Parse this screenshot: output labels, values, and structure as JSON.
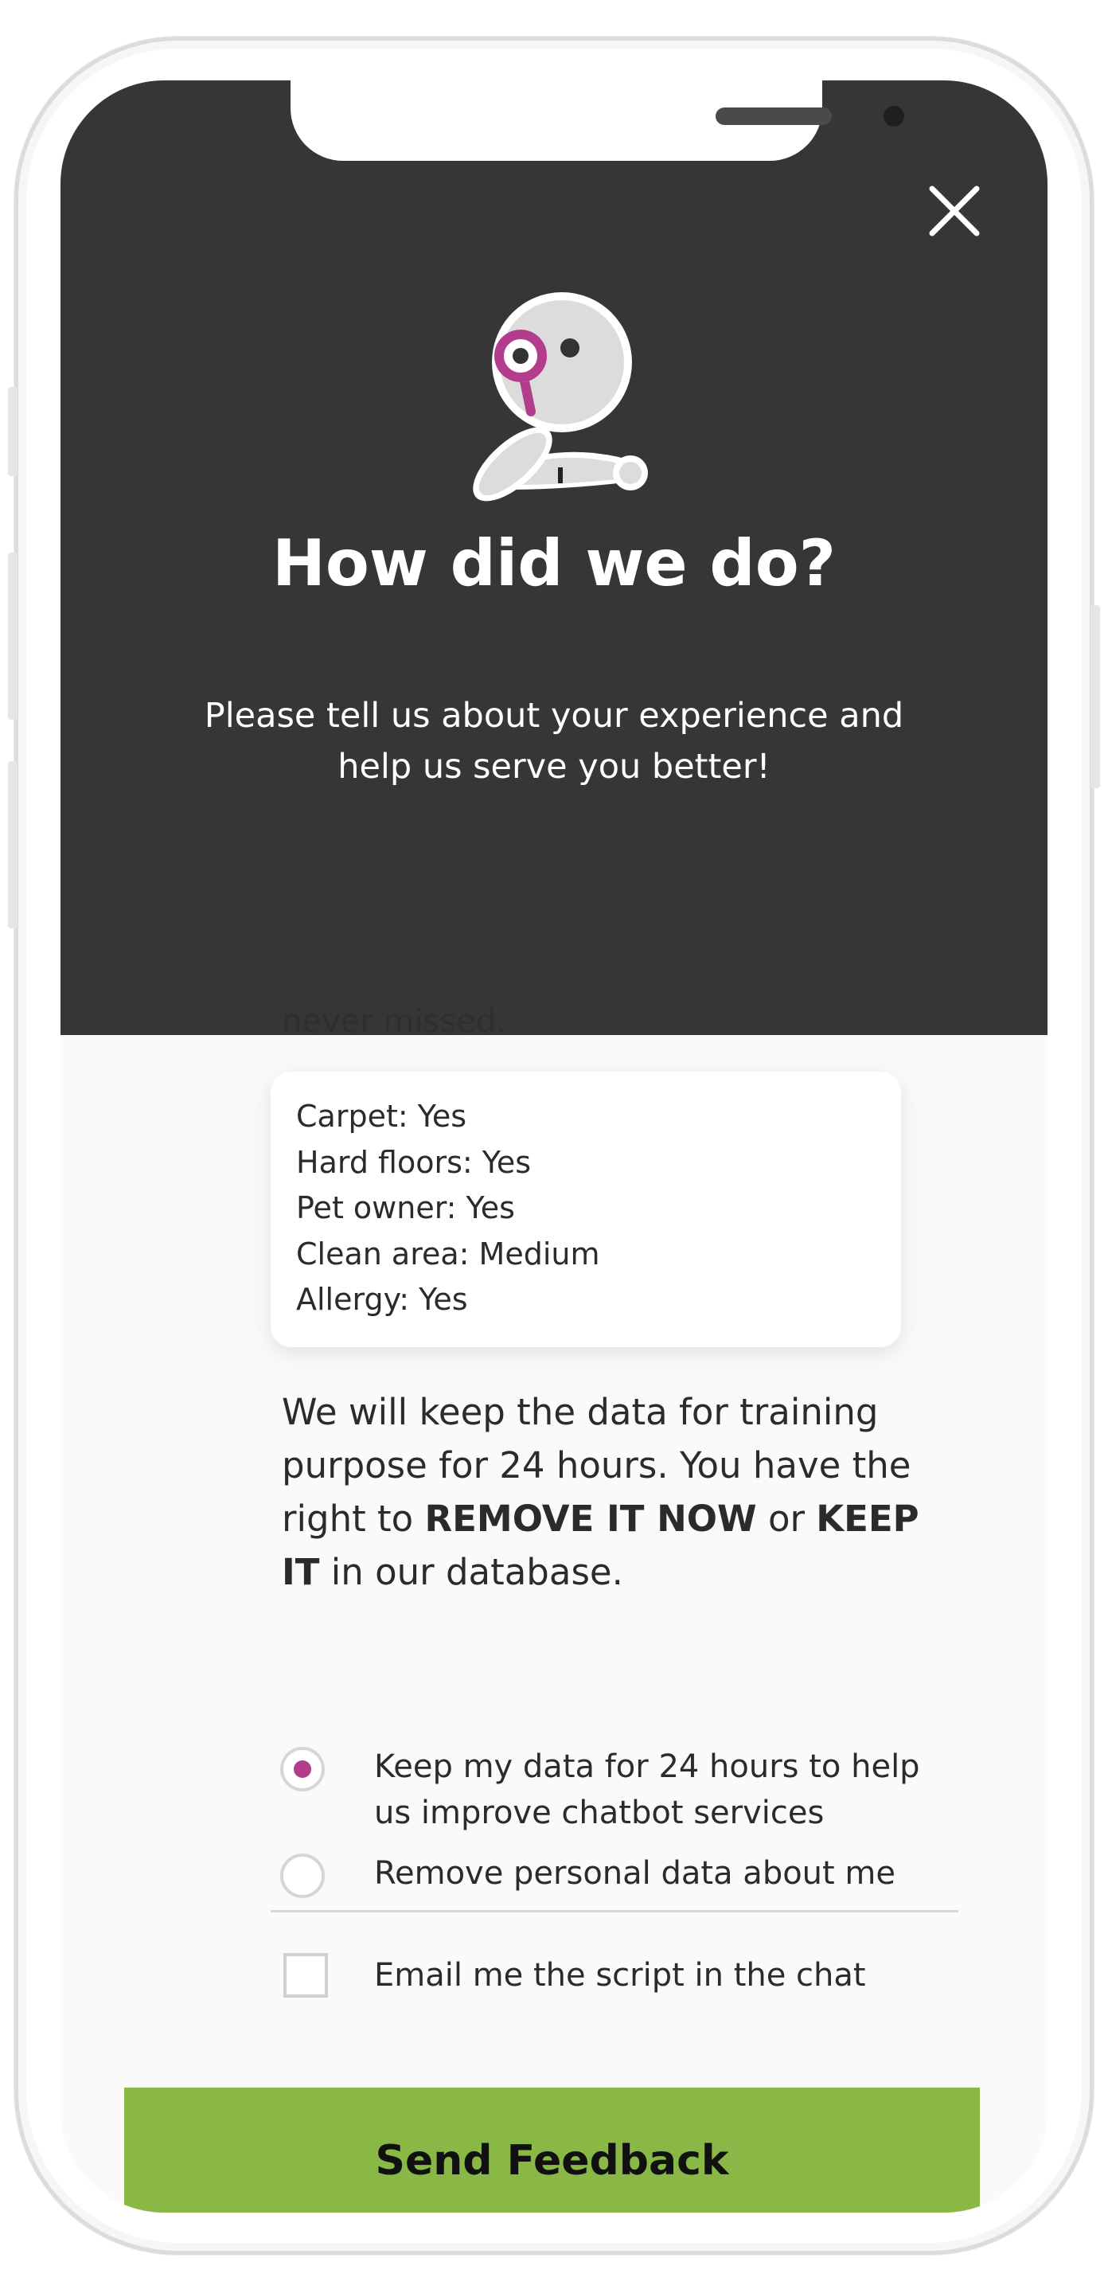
{
  "header": {
    "title": "How did we do?",
    "subtitle": "Please tell us about your experience and help us serve you better!",
    "close_icon": "close-icon",
    "mascot_icon": "robot-magnifier-icon"
  },
  "summary": {
    "cut_off_text": "never missed.",
    "items": [
      "Carpet: Yes",
      "Hard floors: Yes",
      "Pet owner: Yes",
      "Clean area: Medium",
      "Allergy: Yes"
    ]
  },
  "notice": {
    "part1": "We will keep the data for training purpose for 24 hours. You have the right to ",
    "remove_bold": "REMOVE IT NOW",
    "part2": " or ",
    "keep_bold": "KEEP IT",
    "part3": " in our database."
  },
  "options": {
    "keep_label": "Keep my data for 24 hours to help us improve chatbot services",
    "remove_label": "Remove personal data about me",
    "selected": "keep"
  },
  "email": {
    "label": "Email me the script in the chat",
    "checked": false
  },
  "send_button": {
    "label": "Send Feedback"
  },
  "colors": {
    "header_bg": "#363636",
    "accent": "#b13d8c",
    "button_bg": "#8ab847",
    "content_bg": "#fafafa"
  }
}
